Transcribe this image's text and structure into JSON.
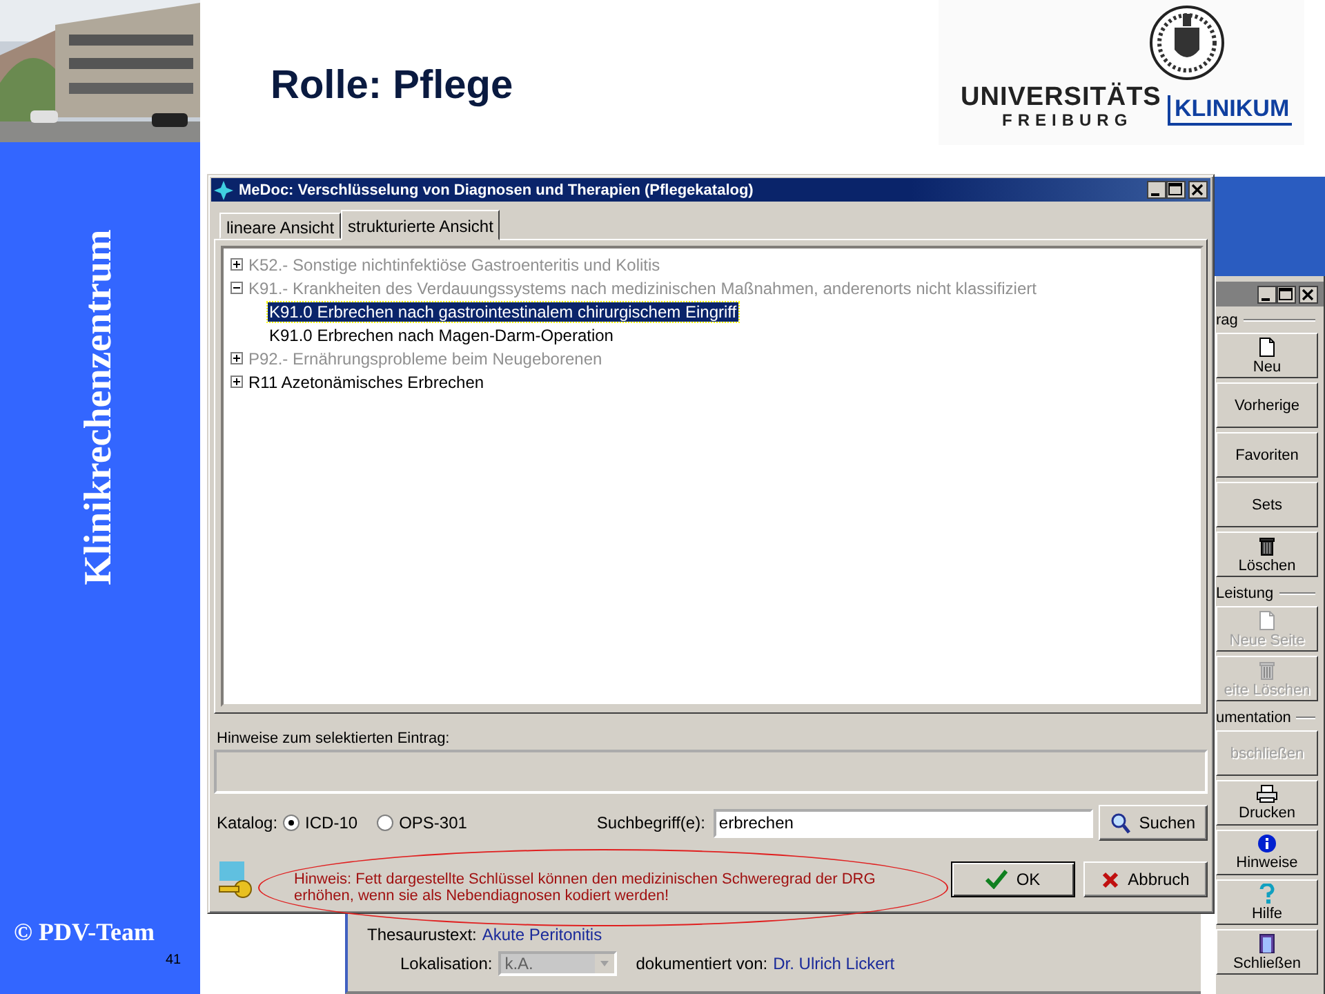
{
  "slide": {
    "title": "Rolle: Pflege",
    "sidebar_text": "Klinikrechenzentrum",
    "copyright": "© PDV-Team",
    "page_number": "41",
    "logo": {
      "line_1": "UNIVERSITÄTS",
      "line_2": "FREIBURG",
      "line_3": "KLINIKUM"
    }
  },
  "dialog": {
    "title": "MeDoc: Verschlüsselung von Diagnosen und Therapien (Pflegekatalog)",
    "tabs": [
      {
        "label": "lineare Ansicht",
        "selected": false
      },
      {
        "label": "strukturierte Ansicht",
        "selected": true
      }
    ],
    "tree": [
      {
        "label": "K52.- Sonstige nichtinfektiöse Gastroenteritis und Kolitis",
        "greyed": true,
        "expanded": false,
        "selected": false
      },
      {
        "label": "K91.- Krankheiten des Verdauungssystems nach medizinischen Maßnahmen, anderenorts nicht klassifiziert",
        "greyed": true,
        "expanded": true,
        "selected": false,
        "children": [
          {
            "label": "K91.0 Erbrechen nach gastrointestinalem chirurgischem Eingriff",
            "greyed": false,
            "selected": true
          },
          {
            "label": "K91.0 Erbrechen nach Magen-Darm-Operation",
            "greyed": false,
            "selected": false
          }
        ]
      },
      {
        "label": "P92.- Ernährungsprobleme beim Neugeborenen",
        "greyed": true,
        "expanded": false,
        "selected": false
      },
      {
        "label": "R11 Azetonämisches Erbrechen",
        "greyed": false,
        "expanded": false,
        "selected": false
      }
    ],
    "hint_label": "Hinweise zum selektierten Eintrag:",
    "catalog_label": "Katalog:",
    "catalogs": [
      {
        "label": "ICD-10",
        "selected": true
      },
      {
        "label": "OPS-301",
        "selected": false
      }
    ],
    "search_label": "Suchbegriff(e):",
    "search_value": "erbrechen",
    "search_button": "Suchen",
    "notice": "Hinweis: Fett dargestellte Schlüssel können den medizinischen Schweregrad der DRG erhöhen, wenn sie als Nebendiagnosen kodiert werden!",
    "buttons": [
      {
        "label": "OK",
        "kind": "ok"
      },
      {
        "label": "Abbruch",
        "kind": "cancel"
      }
    ]
  },
  "back_window": {
    "groups": [
      {
        "title": "rag",
        "buttons": [
          {
            "label": "Neu",
            "kind": "page",
            "disabled": false
          },
          {
            "label": "Vorherige",
            "kind": "text",
            "disabled": false
          },
          {
            "label": "Favoriten",
            "kind": "text",
            "disabled": false
          },
          {
            "label": "Sets",
            "kind": "text",
            "disabled": false
          },
          {
            "label": "Löschen",
            "kind": "trash",
            "disabled": false
          }
        ]
      },
      {
        "title": "Leistung",
        "buttons": [
          {
            "label": "Neue Seite",
            "kind": "page",
            "disabled": true
          },
          {
            "label": "eite Löschen",
            "kind": "trash",
            "disabled": true
          }
        ]
      },
      {
        "title": "umentation",
        "buttons": [
          {
            "label": "bschließen",
            "kind": "text",
            "disabled": true
          },
          {
            "label": "Drucken",
            "kind": "printer",
            "disabled": false
          },
          {
            "label": "Hinweise",
            "kind": "info",
            "disabled": false
          },
          {
            "label": "Hilfe",
            "kind": "help",
            "disabled": false
          },
          {
            "label": "Schließen",
            "kind": "door",
            "disabled": false
          }
        ]
      }
    ],
    "thesaurus_label": "Thesaurustext:",
    "thesaurus_value": "Akute Peritonitis",
    "localisation_label": "Lokalisation:",
    "localisation_value": "k.A.",
    "documented_label": "dokumentiert von:",
    "documented_value": "Dr. Ulrich Lickert"
  }
}
